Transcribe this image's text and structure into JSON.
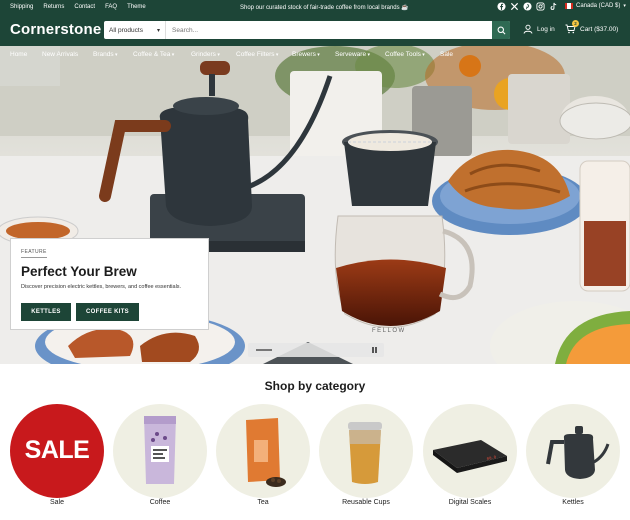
{
  "topbar": {
    "links": [
      "Shipping",
      "Returns",
      "Contact",
      "FAQ",
      "Theme"
    ],
    "promo": "Shop our curated stock of fair-trade coffee from local brands ☕",
    "social_icons": [
      "facebook-icon",
      "x-icon",
      "pinterest-icon",
      "instagram-icon",
      "tiktok-icon"
    ],
    "currency": "Canada (CAD $)"
  },
  "header": {
    "logo": "Cornerstone",
    "search_category": "All products",
    "search_placeholder": "Search...",
    "login_label": "Log in",
    "cart_label": "Cart ($37.00)",
    "cart_count": "2"
  },
  "nav": {
    "items": [
      "Home",
      "New Arrivals",
      "Brands",
      "Coffee & Tea",
      "Grinders",
      "Coffee Filters",
      "Brewers",
      "Serveware",
      "Coffee Tools",
      "Sale"
    ]
  },
  "hero": {
    "eyebrow": "FEATURE",
    "title": "Perfect Your Brew",
    "description": "Discover precision electric kettles, brewers, and coffee essentials.",
    "button_1": "KETTLES",
    "button_2": "COFFEE KITS",
    "server_brand": "FELLOW"
  },
  "categories": {
    "title": "Shop by category",
    "items": [
      {
        "label": "Sale",
        "badge": "SALE"
      },
      {
        "label": "Coffee"
      },
      {
        "label": "Tea"
      },
      {
        "label": "Reusable Cups"
      },
      {
        "label": "Digital Scales",
        "display": "00.0"
      },
      {
        "label": "Kettles"
      }
    ]
  },
  "colors": {
    "brand_green": "#1d4537",
    "sale_red": "#c8191c",
    "category_bg": "#efefe3"
  }
}
